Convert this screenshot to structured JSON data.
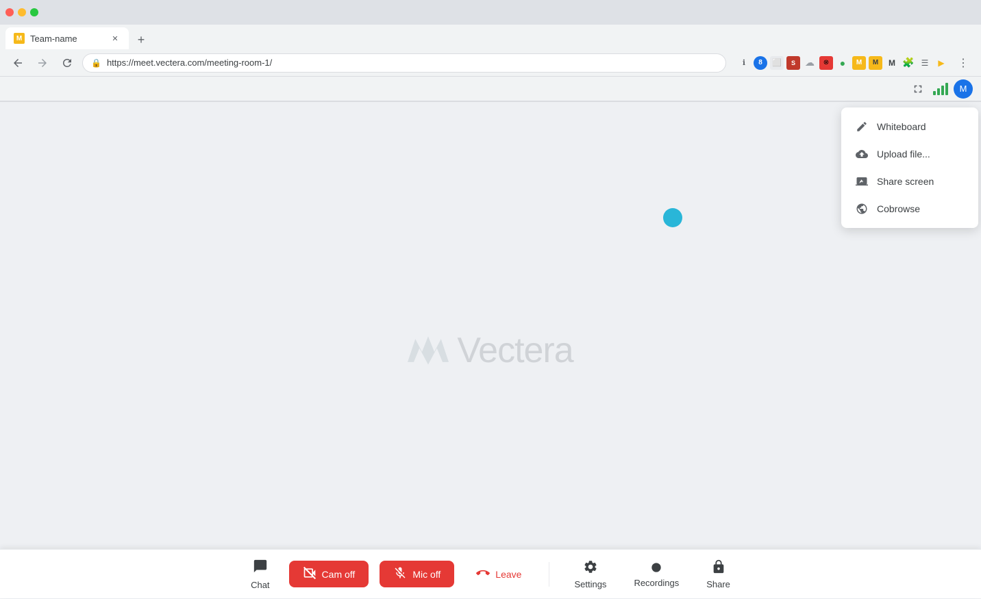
{
  "browser": {
    "tab_title": "Team-name",
    "url": "https://meet.vectera.com/meeting-room-1/",
    "tab_favicon": "M"
  },
  "toolbar": {
    "fullscreen_icon": "⛶",
    "avatar_label": "M"
  },
  "dropdown": {
    "whiteboard_label": "Whiteboard",
    "upload_label": "Upload file...",
    "share_screen_label": "Share screen",
    "cobrowse_label": "Cobrowse"
  },
  "logo": {
    "text": "Vectera"
  },
  "bottom_bar": {
    "chat_label": "Chat",
    "cam_off_label": "Cam off",
    "mic_off_label": "Mic off",
    "leave_label": "Leave",
    "settings_label": "Settings",
    "recordings_label": "Recordings",
    "share_label": "Share"
  },
  "colors": {
    "red_button": "#e53935",
    "teal_accent": "#00838f",
    "blue_dot": "#29b6d8",
    "signal_green": "#34a853"
  }
}
